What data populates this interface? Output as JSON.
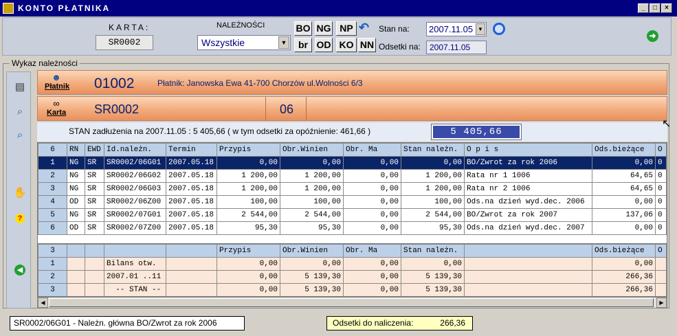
{
  "window": {
    "title": "KONTO PŁATNIKA"
  },
  "karta": {
    "label": "KARTA:",
    "value": "SR0002"
  },
  "naleznosci": {
    "label": "NALEŻNOŚCI",
    "value": "Wszystkie"
  },
  "buttons": [
    "BO",
    "NG",
    "NP",
    "br",
    "OD",
    "KO",
    "NN"
  ],
  "stan": {
    "label": "Stan na:",
    "value": "2007.11.05",
    "odsetki_label": "Odsetki  na:",
    "odsetki_value": "2007.11.05"
  },
  "group_label": "Wykaz należności",
  "platnik": {
    "label": "Płatnik",
    "id": "01002",
    "desc": "Płatnik: Janowska Ewa   41-700 Chorzów ul.Wolności 6/3"
  },
  "karta_band": {
    "label": "Karta",
    "value": "SR0002",
    "num": "06"
  },
  "stan_line": {
    "text": "STAN zadłużenia na 2007.11.05  : 5 405,66   ( w tym odsetki za opóźnienie: 461,66 )",
    "total": "5 405,66"
  },
  "table1": {
    "headers": [
      "6",
      "RN",
      "EWD",
      "Id.należn.",
      "Termin",
      "Przypis",
      "Obr.Winien",
      "Obr. Ma",
      "Stan należn.",
      "O p i s",
      "Ods.bieżące",
      "O"
    ],
    "rows": [
      [
        "1",
        "NG",
        "SR",
        "SR0002/06G01",
        "2007.05.18",
        "0,00",
        "0,00",
        "0,00",
        "0,00",
        "BO/Zwrot za rok 2006",
        "0,00",
        "0"
      ],
      [
        "2",
        "NG",
        "SR",
        "SR0002/06G02",
        "2007.05.18",
        "1 200,00",
        "1 200,00",
        "0,00",
        "1 200,00",
        "Rata nr 1 1006",
        "64,65",
        "0"
      ],
      [
        "3",
        "NG",
        "SR",
        "SR0002/06G03",
        "2007.05.18",
        "1 200,00",
        "1 200,00",
        "0,00",
        "1 200,00",
        "Rata nr 2 1006",
        "64,65",
        "0"
      ],
      [
        "4",
        "OD",
        "SR",
        "SR0002/06Z00",
        "2007.05.18",
        "100,00",
        "100,00",
        "0,00",
        "100,00",
        "Ods.na dzień wyd.dec. 2006",
        "0,00",
        "0"
      ],
      [
        "5",
        "NG",
        "SR",
        "SR0002/07G01",
        "2007.05.18",
        "2 544,00",
        "2 544,00",
        "0,00",
        "2 544,00",
        "BO/Zwrot za rok 2007",
        "137,06",
        "0"
      ],
      [
        "6",
        "OD",
        "SR",
        "SR0002/07Z00",
        "2007.05.18",
        "95,30",
        "95,30",
        "0,00",
        "95,30",
        "Ods.na dzień wyd.dec. 2007",
        "0,00",
        "0"
      ]
    ]
  },
  "table2": {
    "headers": [
      "3",
      "",
      "",
      "",
      "",
      "Przypis",
      "Obr.Winien",
      "Obr. Ma",
      "Stan należn.",
      "",
      "Ods.bieżące",
      "O"
    ],
    "rows": [
      [
        "1",
        "",
        "",
        "Bilans otw.",
        "",
        "0,00",
        "0,00",
        "0,00",
        "0,00",
        "",
        "0,00",
        ""
      ],
      [
        "2",
        "",
        "",
        "2007.01 ..11",
        "",
        "0,00",
        "5 139,30",
        "0,00",
        "5 139,30",
        "",
        "266,36",
        ""
      ],
      [
        "3",
        "",
        "",
        "  -- STAN --",
        "",
        "0,00",
        "5 139,30",
        "0,00",
        "5 139,30",
        "",
        "266,36",
        ""
      ]
    ]
  },
  "status": {
    "left": "SR0002/06G01 - Należn. główna    BO/Zwrot za rok 2006",
    "right_label": "Odsetki do naliczenia:",
    "right_value": "266,36"
  }
}
